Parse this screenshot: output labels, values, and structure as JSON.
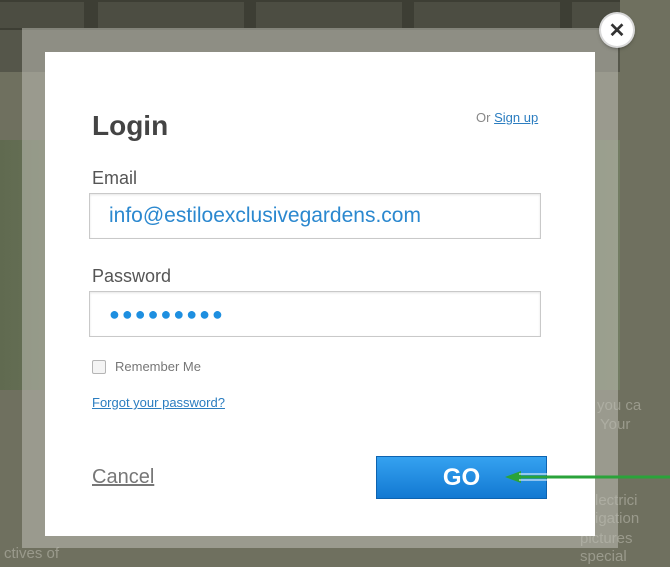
{
  "modal": {
    "title": "Login",
    "signup_prefix": "Or",
    "signup_link": "Sign up",
    "email_label": "Email",
    "email_value": "info@estiloexclusivegardens.com",
    "password_label": "Password",
    "password_mask": "●●●●●●●●●",
    "remember_label": "Remember Me",
    "forgot_link": "Forgot your password?",
    "cancel_label": "Cancel",
    "go_label": "GO",
    "close_icon": "close-icon"
  },
  "background": {
    "text_a": "ctives of",
    "text_b": "you ca",
    "text_c": "Your",
    "text_d": "lectrici",
    "text_e": "igation",
    "text_f": "pictures",
    "text_g": "special"
  },
  "colors": {
    "accent": "#1e8fe0",
    "arrow": "#2aa33a"
  }
}
